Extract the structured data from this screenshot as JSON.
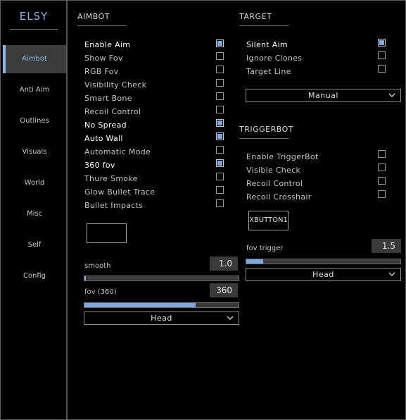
{
  "brand": "ELSY",
  "nav": [
    "Aimbot",
    "Anti Aim",
    "Outlines",
    "Visuals",
    "World",
    "Misc",
    "Self",
    "Config"
  ],
  "aimbot": {
    "title": "AIMBOT",
    "options": [
      {
        "label": "Enable Aim",
        "checked": true
      },
      {
        "label": "Show Fov",
        "checked": false
      },
      {
        "label": "RGB Fov",
        "checked": false
      },
      {
        "label": "Visibility Check",
        "checked": false
      },
      {
        "label": "Smart Bone",
        "checked": false
      },
      {
        "label": "Recoil Control",
        "checked": false
      },
      {
        "label": "No Spread",
        "checked": true
      },
      {
        "label": "Auto Wall",
        "checked": true
      },
      {
        "label": "Automatic Mode",
        "checked": false
      },
      {
        "label": "360 fov",
        "checked": true
      },
      {
        "label": "Thure Smoke",
        "checked": false
      },
      {
        "label": "Glow Bullet Trace",
        "checked": false
      },
      {
        "label": "Bullet Impacts",
        "checked": false
      }
    ],
    "keybind": "",
    "smooth": {
      "label": "smooth",
      "value": "1.0",
      "fraction": 0.0
    },
    "fov": {
      "label": "fov (360)",
      "value": "360",
      "fraction": 0.72
    },
    "hitbox": "Head"
  },
  "target": {
    "title": "TARGET",
    "options": [
      {
        "label": "Silent Aim",
        "checked": true
      },
      {
        "label": "Ignore Clones",
        "checked": false
      },
      {
        "label": "Target Line",
        "checked": false
      }
    ],
    "mode": "Manual"
  },
  "triggerbot": {
    "title": "TRIGGERBOT",
    "options": [
      {
        "label": "Enable TriggerBot",
        "checked": false
      },
      {
        "label": "Visible Check",
        "checked": false
      },
      {
        "label": "Recoil Control",
        "checked": false
      },
      {
        "label": "Recoil Crosshair",
        "checked": false
      }
    ],
    "keybind": "XBUTTON1",
    "fov_trigger": {
      "label": "fov trigger",
      "value": "1.5",
      "fraction": 0.11
    },
    "hitbox": "Head"
  },
  "colors": {
    "accent": "#7ea7e6",
    "brand": "#8fb4ea",
    "panel": "#3a3a3a",
    "background": "#000000"
  }
}
